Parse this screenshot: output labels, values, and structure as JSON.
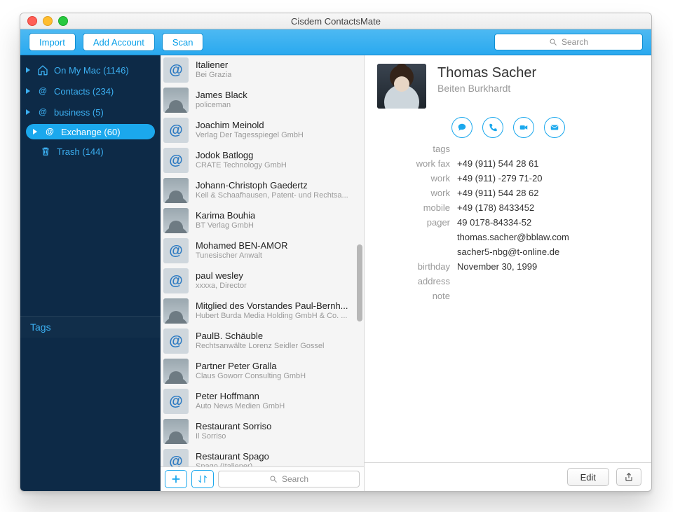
{
  "window": {
    "title": "Cisdem ContactsMate"
  },
  "toolbar": {
    "import": "Import",
    "add_account": "Add Account",
    "scan": "Scan",
    "search_placeholder": "Search"
  },
  "sidebar": {
    "items": [
      {
        "icon": "home-icon",
        "label": "On My Mac (1146)"
      },
      {
        "icon": "at-icon",
        "label": "Contacts (234)"
      },
      {
        "icon": "at-icon",
        "label": "business (5)"
      },
      {
        "icon": "at-icon",
        "label": "Exchange (60)",
        "selected": true
      },
      {
        "icon": "trash-icon",
        "label": "Trash (144)",
        "indent": true
      }
    ],
    "tags_label": "Tags"
  },
  "contacts": {
    "search_placeholder": "Search",
    "items": [
      {
        "name": "Italiener",
        "sub": "Bei Grazia",
        "avatar": "at"
      },
      {
        "name": "James Black",
        "sub": "policeman",
        "avatar": "person"
      },
      {
        "name": "Joachim Meinold",
        "sub": "Verlag Der Tagesspiegel GmbH",
        "avatar": "at"
      },
      {
        "name": "Jodok Batlogg",
        "sub": "CRATE Technology GmbH",
        "avatar": "at"
      },
      {
        "name": "Johann-Christoph Gaedertz",
        "sub": "Keil & Schaafhausen, Patent- und Rechtsa...",
        "avatar": "person"
      },
      {
        "name": "Karima Bouhia",
        "sub": "BT Verlag GmbH",
        "avatar": "person"
      },
      {
        "name": "Mohamed BEN-AMOR",
        "sub": "Tunesischer Anwalt",
        "avatar": "at"
      },
      {
        "name": "paul wesley",
        "sub": "xxxxa, Director",
        "avatar": "at"
      },
      {
        "name": "Mitglied des Vorstandes Paul-Bernh...",
        "sub": "Hubert Burda Media Holding GmbH & Co. ...",
        "avatar": "person"
      },
      {
        "name": "PaulB. Schäuble",
        "sub": "Rechtsanwälte Lorenz Seidler Gossel",
        "avatar": "at"
      },
      {
        "name": "Partner Peter Gralla",
        "sub": "Claus Goworr Consulting GmbH",
        "avatar": "person"
      },
      {
        "name": "Peter Hoffmann",
        "sub": "Auto News Medien GmbH",
        "avatar": "at"
      },
      {
        "name": "Restaurant Sorriso",
        "sub": "Il Sorriso",
        "avatar": "person"
      },
      {
        "name": "Restaurant Spago",
        "sub": "Spago (Italiener)",
        "avatar": "at"
      }
    ]
  },
  "details": {
    "name": "Thomas Sacher",
    "company": "Beiten Burkhardt",
    "labels": {
      "tags": "tags",
      "birthday": "birthday",
      "address": "address",
      "note": "note"
    },
    "phones": [
      {
        "label": "work fax",
        "value": "+49 (911) 544 28 61"
      },
      {
        "label": "work",
        "value": "+49 (911) -279 71-20"
      },
      {
        "label": "work",
        "value": "+49 (911) 544 28 62"
      },
      {
        "label": "mobile",
        "value": "+49 (178) 8433452"
      },
      {
        "label": "pager",
        "value": "49 0178-84334-52"
      }
    ],
    "emails": [
      "thomas.sacher@bblaw.com",
      "sacher5-nbg@t-online.de"
    ],
    "birthday": "November 30, 1999",
    "edit_label": "Edit"
  }
}
